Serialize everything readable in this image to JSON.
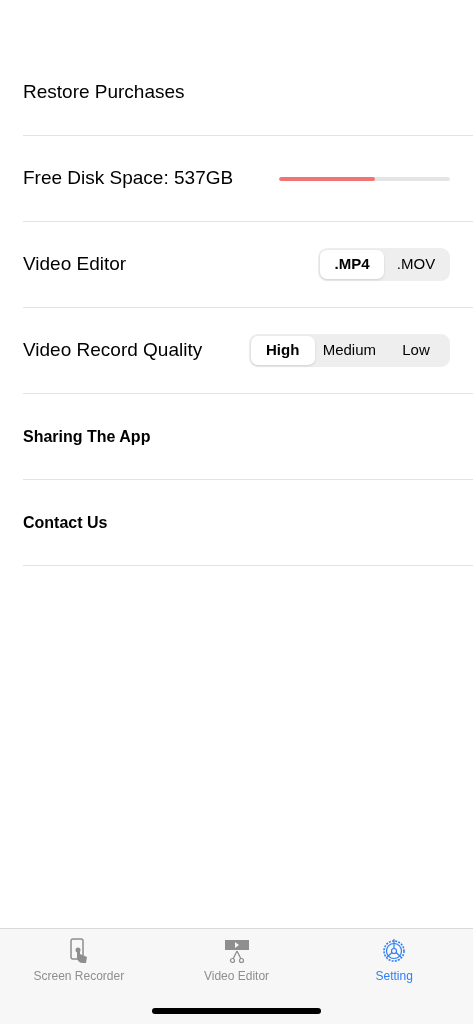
{
  "settings": [
    {
      "kind": "plain",
      "label": "Restore Purchases"
    },
    {
      "kind": "meter",
      "label": "Free Disk Space: 537GB",
      "level": 0.56
    },
    {
      "kind": "segmented",
      "label": "Video Editor",
      "options": [
        {
          "label": ".MP4",
          "selected": true
        },
        {
          "label": ".MOV",
          "selected": false
        }
      ]
    },
    {
      "kind": "segmented",
      "label": "Video Record Quality",
      "options": [
        {
          "label": "High",
          "selected": true
        },
        {
          "label": "Medium",
          "selected": false
        },
        {
          "label": "Low",
          "selected": false
        }
      ]
    },
    {
      "kind": "action",
      "label": "Sharing The App"
    },
    {
      "kind": "action",
      "label": "Contact Us"
    }
  ],
  "tab_bar": [
    {
      "label": "Screen Recorder",
      "selected": false
    },
    {
      "label": "Video Editor",
      "selected": false
    },
    {
      "label": "Setting",
      "selected": true
    }
  ]
}
